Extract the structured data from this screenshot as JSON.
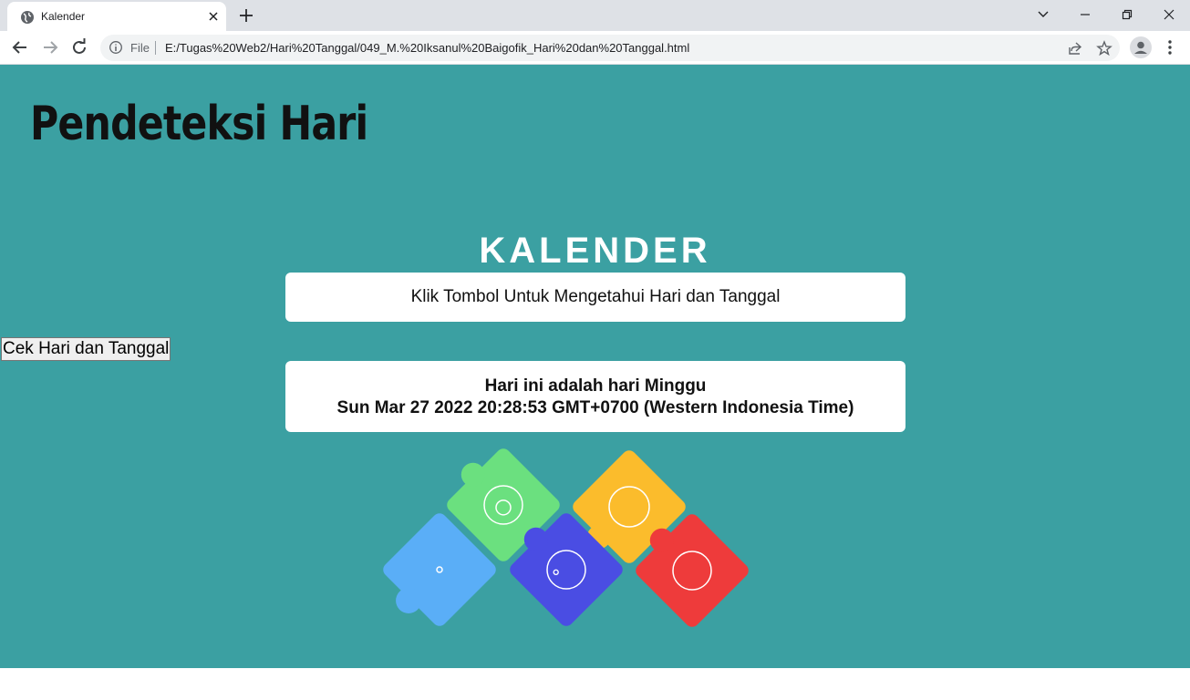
{
  "browser": {
    "tab": {
      "title": "Kalender",
      "favicon": "globe-icon",
      "close_icon": "close-icon"
    },
    "new_tab_icon": "plus-icon",
    "window_controls": [
      "chevron-down-icon",
      "minimize-icon",
      "restore-icon",
      "close-icon"
    ],
    "address_bar": {
      "security_label": "File",
      "url": "E:/Tugas%20Web2/Hari%20Tanggal/049_M.%20Iksanul%20Baigofik_Hari%20dan%20Tanggal.html",
      "icons": [
        "share-icon",
        "star-icon"
      ]
    }
  },
  "page": {
    "logo_title": "Pendeteksi Hari",
    "heading": "KALENDER",
    "prompt_text": "Klik Tombol Untuk Mengetahui Hari dan Tanggal",
    "button_label": "Cek Hari dan Tanggal",
    "result_line1": "Hari ini adalah hari Minggu",
    "result_line2": "Sun Mar 27 2022 20:28:53 GMT+0700 (Western Indonesia Time)",
    "illustration": "puzzle-pieces-illustration",
    "colors": {
      "background": "#3ba0a2",
      "card": "#ffffff",
      "piece_light_blue": "#5aaef7",
      "piece_green": "#6be07f",
      "piece_indigo": "#4a4de3",
      "piece_orange": "#fbbc2c",
      "piece_red": "#ee3b3b"
    }
  }
}
